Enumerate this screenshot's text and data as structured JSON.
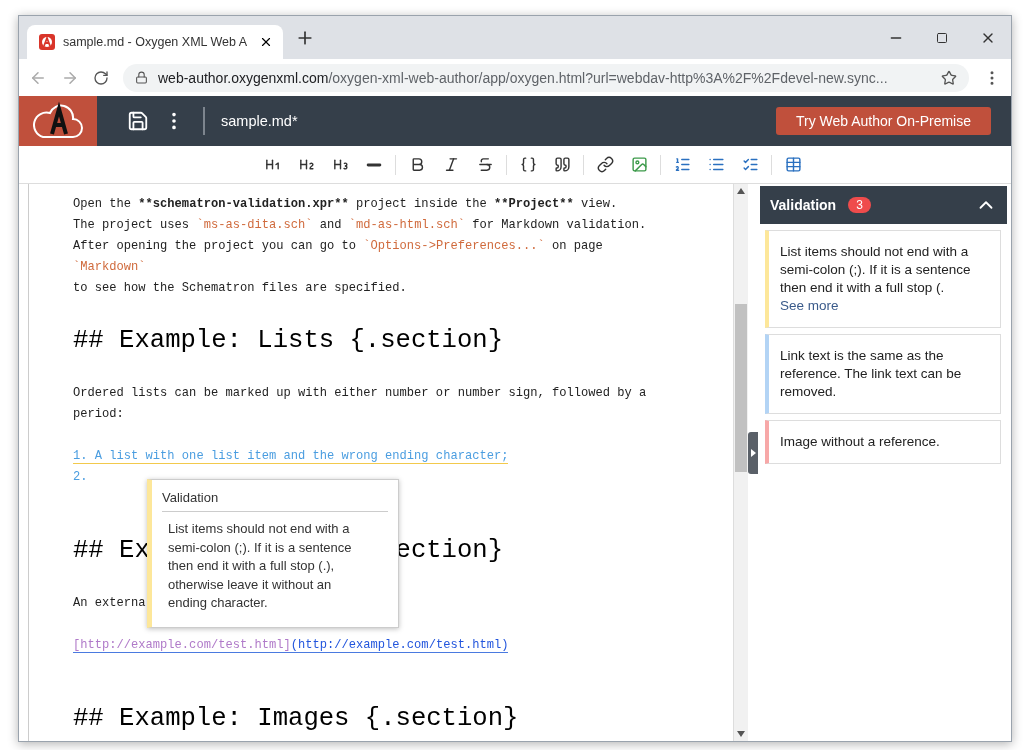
{
  "browser": {
    "tab_title": "sample.md - Oxygen XML Web A",
    "url_domain": "web-author.oxygenxml.com",
    "url_path": "/oxygen-xml-web-author/app/oxygen.html?url=webdav-http%3A%2F%2Fdevel-new.sync..."
  },
  "header": {
    "file_name": "sample.md*",
    "button": "Try Web Author On-Premise"
  },
  "toolbar": [
    {
      "kind": "h1"
    },
    {
      "kind": "h2"
    },
    {
      "kind": "h3"
    },
    {
      "kind": "rule"
    },
    {
      "kind": "sep"
    },
    {
      "kind": "bold"
    },
    {
      "kind": "italic"
    },
    {
      "kind": "strike"
    },
    {
      "kind": "sep"
    },
    {
      "kind": "code"
    },
    {
      "kind": "quote"
    },
    {
      "kind": "sep"
    },
    {
      "kind": "link"
    },
    {
      "kind": "image"
    },
    {
      "kind": "sep"
    },
    {
      "kind": "ordered"
    },
    {
      "kind": "bullets"
    },
    {
      "kind": "tasks"
    },
    {
      "kind": "sep"
    },
    {
      "kind": "table"
    }
  ],
  "editor": {
    "lines": [
      {
        "kind": "text",
        "segments": [
          {
            "kind": "plain",
            "text": "Open the "
          },
          {
            "kind": "strong",
            "text": "**schematron-validation.xpr**"
          },
          {
            "kind": "plain",
            "text": " project inside the "
          },
          {
            "kind": "strong",
            "text": "**Project**"
          },
          {
            "kind": "plain",
            "text": " view."
          }
        ]
      },
      {
        "kind": "text",
        "segments": [
          {
            "kind": "plain",
            "text": "The project uses "
          },
          {
            "kind": "code",
            "text": "`ms-as-dita.sch`"
          },
          {
            "kind": "plain",
            "text": " and "
          },
          {
            "kind": "code",
            "text": "`md-as-html.sch`"
          },
          {
            "kind": "plain",
            "text": " for Markdown validation."
          }
        ]
      },
      {
        "kind": "text",
        "segments": [
          {
            "kind": "plain",
            "text": "After opening the project you can go to "
          },
          {
            "kind": "code",
            "text": "`Options->Preferences...`"
          },
          {
            "kind": "plain",
            "text": " on page"
          }
        ]
      },
      {
        "kind": "text",
        "segments": [
          {
            "kind": "code",
            "text": "`Markdown`"
          }
        ]
      },
      {
        "kind": "text",
        "segments": [
          {
            "kind": "plain",
            "text": "to see how the Schematron files are specified."
          }
        ]
      },
      {
        "kind": "heading",
        "segments": [
          {
            "kind": "plain",
            "text": "## Example: Lists {.section}"
          }
        ]
      },
      {
        "kind": "text",
        "segments": [
          {
            "kind": "plain",
            "text": "Ordered lists can be marked up with either number or number sign, followed by a"
          }
        ]
      },
      {
        "kind": "text",
        "segments": [
          {
            "kind": "plain",
            "text": "period:"
          }
        ]
      },
      {
        "kind": "blank"
      },
      {
        "kind": "text",
        "segments": [
          {
            "kind": "listitem",
            "text": "1. A list with one list item and the wrong ending character;",
            "flagged": true
          }
        ]
      },
      {
        "kind": "text",
        "segments": [
          {
            "kind": "listitem",
            "text": "2.",
            "flagged": false
          }
        ]
      },
      {
        "kind": "blank"
      },
      {
        "kind": "heading",
        "segments": [
          {
            "kind": "plain",
            "text": "## Ex"
          },
          {
            "kind": "hidden"
          },
          {
            "kind": "plain",
            "text": "ection}"
          }
        ]
      },
      {
        "kind": "text",
        "segments": [
          {
            "kind": "plain",
            "text": "An externa"
          }
        ]
      },
      {
        "kind": "blank"
      },
      {
        "kind": "text",
        "segments": [
          {
            "kind": "linktext",
            "text": "[http://example.com/test.html]"
          },
          {
            "kind": "linkurl",
            "text": "(http://example.com/test.html)"
          }
        ]
      },
      {
        "kind": "blank"
      },
      {
        "kind": "heading",
        "segments": [
          {
            "kind": "plain",
            "text": "## Example: Images {.section}"
          }
        ]
      }
    ]
  },
  "tooltip": {
    "title": "Validation",
    "text": "List items should not end with a semi-colon (;). If it is a sentence then end it with a full stop (.), otherwise leave it without an ending character.",
    "color": "#fde79a"
  },
  "validation": {
    "title": "Validation",
    "count": "3",
    "expanded": true,
    "items": [
      {
        "text": "List items should not end with a semi-colon (;). If it is a sentence then end it with a full stop (.",
        "more": "See more",
        "color": "#fde79a"
      },
      {
        "text": "Link text is the same as the reference. The link text can be removed.",
        "color": "#b3d4f5"
      },
      {
        "text": "Image without a reference.",
        "color": "#f7a8a8"
      }
    ]
  }
}
